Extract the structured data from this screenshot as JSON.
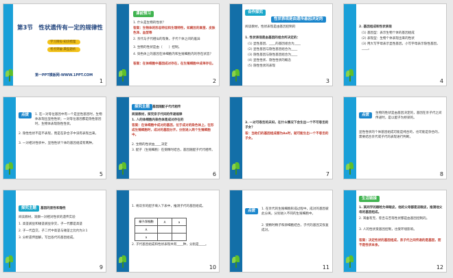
{
  "slides": [
    {
      "num": "1",
      "title": "第3节　性状遗传有一定的规律性",
      "pills": [
        "学习目标·知识梳理",
        "考点突破·典型题析"
      ],
      "footer": "第一PPT模板网-WWW.1PPT.COM"
    },
    {
      "num": "2",
      "tag": "课前预习",
      "lines": [
        "1. 什么是生物的性状？",
        "答案：生物体的形态特征和生理特性，如豌豆的高茎、皮肤色泽、血型等",
        "2. 亲代与子代相似的现象，子代个体之间的差异",
        "3. 生物的性状是由（　　）控制。",
        "4. 染色体上的基因在体细胞内和生殖细胞内的存在状态？",
        "答案：在体细胞中基因成对存在，在生殖细胞中成单存在。"
      ]
    },
    {
      "num": "3",
      "tag": "合作探究",
      "heading": "性状表现是由遗传基因决定的",
      "lines": [
        "阅读教材，性状表现是由基因控制的",
        "1. 性状表现是由基因的组合所决定的：",
        "(1) 显性基因、____的基因组合为____",
        "(2) 显性基因与隐性基因组合为____",
        "(3) 隐性基因与隐性基因组合为____",
        "(4) 显性性状、隐性性状的概念",
        "(5) 隐性性状的表现"
      ]
    },
    {
      "num": "4",
      "lines": [
        "2. 基因组成和性状表现",
        "(1) 基因型：表示生物个体的基因组成",
        "(2) 表现型：生物个体表现出来的性状",
        "(3) 用大写字母表示显性基因，小写字母表示隐性基因，____。"
      ]
    },
    {
      "num": "5",
      "tag": "点拨",
      "lines": [
        "1. 在一对等位基因中有一个是显性基因时，生物体表现出显性性状；一对等位基因都是隐性基因时，生物体表现隐性性状。",
        "2. 隐性性状不是不表现，而是在杂合子中没有表现出来。",
        "3. 一对相对性状中，显性性状个体的基因组成有两种。"
      ]
    },
    {
      "num": "6",
      "tag": "探究主题",
      "heading": "基因随配子代代相传",
      "lines": [
        "阅读教材，探究亲子代间的传递规律",
        "1. 人的体细胞内染色体是成对存在的",
        "答案：在体细胞中成对的基因，位于成对的染色体上，在形成生殖细胞时，成对的基因分开，分别进入两个生殖细胞中。",
        "2. 生物的性状由____决定",
        "3. 配子（生殖细胞）在受精时结合，基因随配子代代相传。"
      ]
    },
    {
      "num": "7",
      "lines": [
        "3. 一对可卷舌的夫妇，在什么情况下会生出一个不可卷舌的子女？",
        "答：当他们的基因组成都为Aa时，就可能生出一个不卷舌的子女。"
      ]
    },
    {
      "num": "8",
      "tag": "点拨",
      "lines": [
        "生物的性状是由基因决定的，基因在亲子代之间传递时，是以配子为桥梁的。",
        "显性性状的个体基因组成可能是纯合的，也可能是杂合的，需要结合亲代或子代的表现进行判断。"
      ]
    },
    {
      "num": "9",
      "tag": "探究主题",
      "heading": "基因的显性和隐性",
      "lines": [
        "阅读教材，观察一对相对性状的遗传实验",
        "1. 高茎豌豆和矮茎豌豆杂交，子一代都是高茎",
        "2. 子一代自交，子二代中高茎与矮茎之比约为3:1",
        "3. 分析遗传图解，写出各代的基因组成。"
      ]
    },
    {
      "num": "10",
      "lines": [
        "1. 将双亲的配子填入下表中，推测子代的基因组成。",
        "2. 子代基因组成和性状表现共有____种，分别是____。"
      ],
      "table": {
        "corner": "精子/卵细胞",
        "cols": [
          "A",
          "a"
        ],
        "rows": [
          "A",
          "a"
        ]
      }
    },
    {
      "num": "11",
      "tag": "点拨",
      "lines": [
        "1. 在亲代的生殖细胞形成过程中，成对的基因彼此分离，分别进入不同的生殖细胞中。",
        "2. 受精时精子和卵细胞结合，子代的基因又恢复成对。"
      ]
    },
    {
      "num": "12",
      "tag": "生活链接",
      "lines": [
        "1. 某同学的眼睑为单眼皮，他的父母都是双眼皮，推测他父母的基因组成。",
        "2. 耳垂有无、卷舌与否等性状都是由基因控制的。",
        "3. 人的性状受基因控制，也受环境影响。",
        "答案：决定性状的基因组成，亲子代之间传递的是基因，而不是性状本身。"
      ]
    }
  ],
  "colors": {
    "side": "#1aa0d8",
    "sideDark": "#136fa8",
    "green": "#3fb34f",
    "blue": "#1a86cc",
    "teal": "#18a6c9",
    "red": "#c0392b",
    "title": "#1b3f7a",
    "pill": "#f2c21b"
  }
}
